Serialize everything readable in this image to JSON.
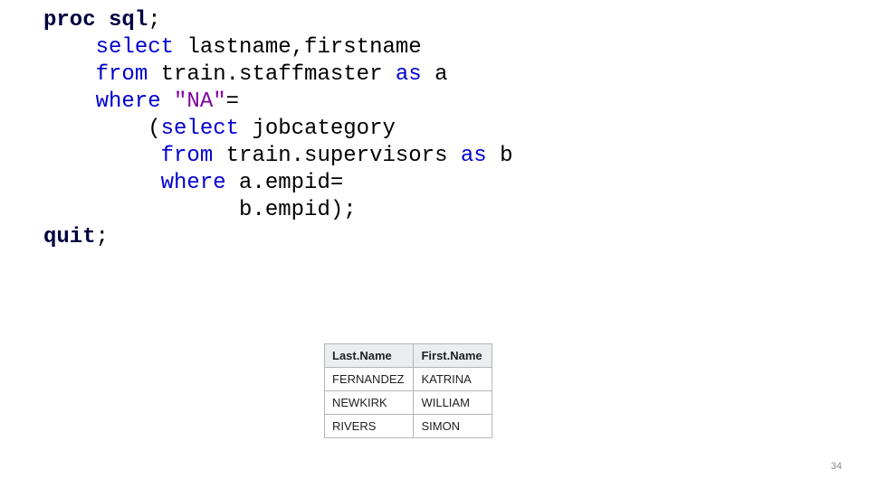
{
  "code": {
    "proc": "proc",
    "sql": "sql",
    "select": "select",
    "cols": "lastname,firstname",
    "from1": "from",
    "tbl1": "train.staffmaster",
    "as1": "as",
    "alias1": "a",
    "where1": "where",
    "lit": "\"NA\"",
    "eq": "=",
    "lparen": "(",
    "select2": "select",
    "col2": "jobcategory",
    "from2": "from",
    "tbl2": "train.supervisors",
    "as2": "as",
    "alias2": "b",
    "where2": "where",
    "cond_a": "a.empid",
    "eq2": "=",
    "cond_b": "b.empid",
    "rparen": ")",
    "semi": ";",
    "quit": "quit"
  },
  "table": {
    "headers": {
      "h1": "Last.Name",
      "h2": "First.Name"
    },
    "rows": [
      {
        "c1": "FERNANDEZ",
        "c2": "KATRINA"
      },
      {
        "c1": "NEWKIRK",
        "c2": "WILLIAM"
      },
      {
        "c1": "RIVERS",
        "c2": "SIMON"
      }
    ]
  },
  "page": "34"
}
